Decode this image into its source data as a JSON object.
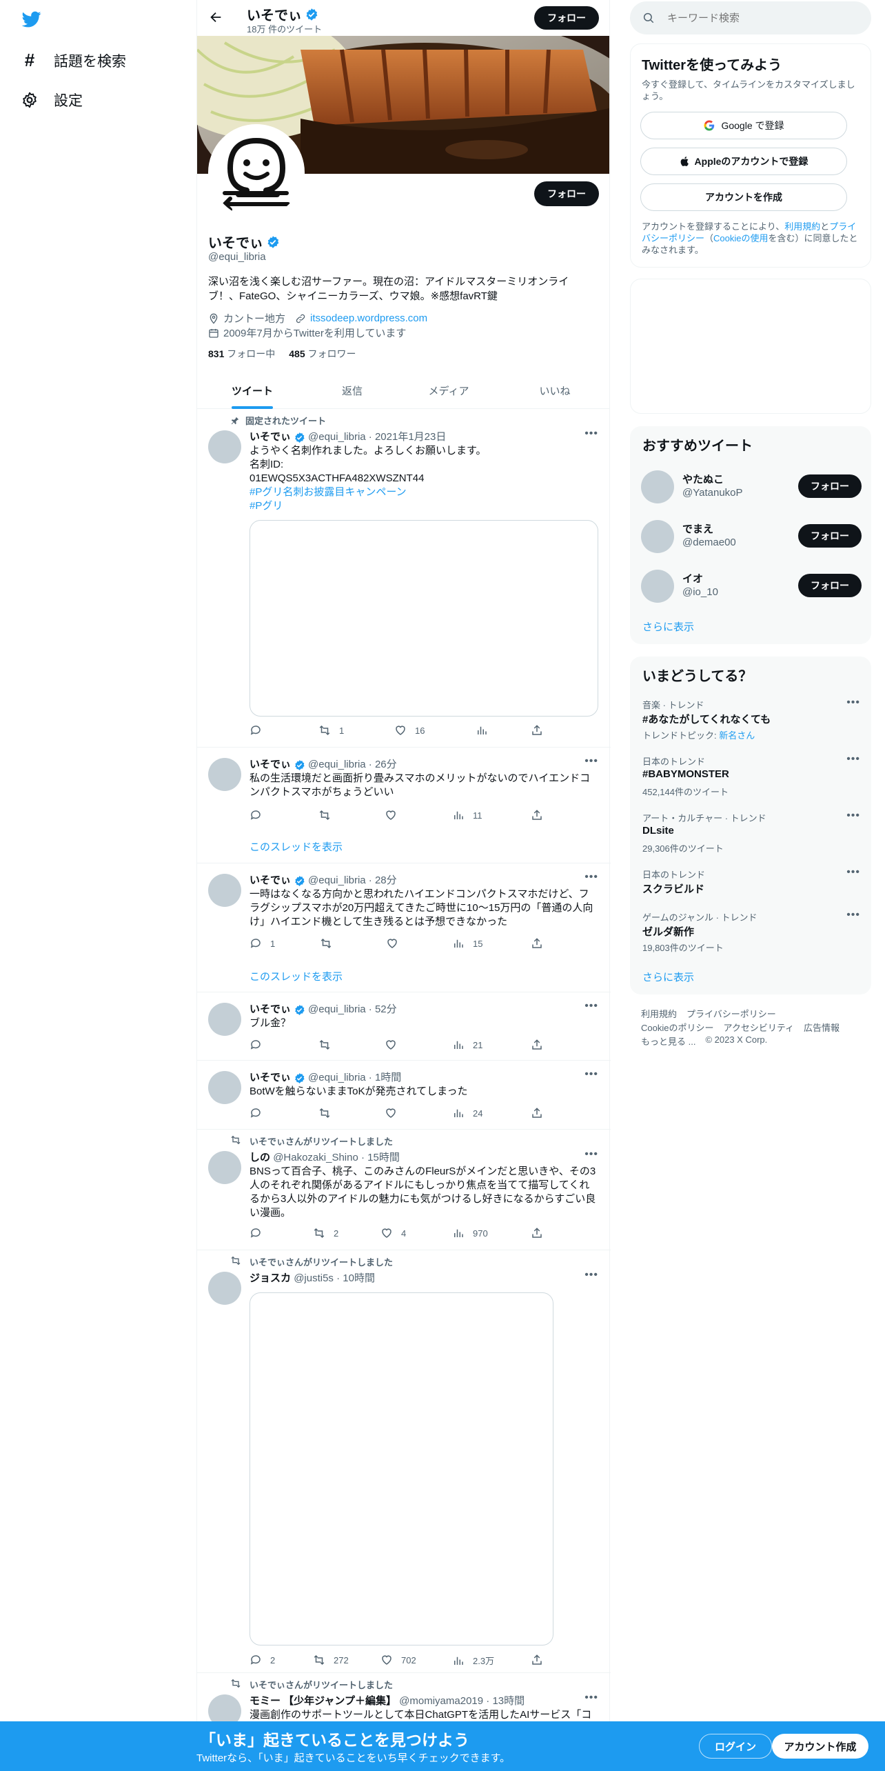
{
  "nav": {
    "explore_label": "話題を検索",
    "settings_label": "設定"
  },
  "header": {
    "name": "いそでぃ",
    "tweet_count": "18万 件のツイート",
    "follow_label": "フォロー"
  },
  "profile": {
    "name": "いそでぃ",
    "handle": "@equi_libria",
    "follow_label": "フォロー",
    "bio_line1": "深い沼を浅く楽しむ沼サーファー。現在の沼：アイドルマスターミリオンライ",
    "bio_line2": "ブ！、FateGO、シャイニーカラーズ、ウマ娘。※感想favRT鍵",
    "location": "カントー地方",
    "website": "itssodeep.wordpress.com",
    "joined": "2009年7月からTwitterを利用しています",
    "following_count": "831",
    "following_label": "フォロー中",
    "followers_count": "485",
    "followers_label": "フォロワー"
  },
  "tabs": [
    {
      "label": "ツイート"
    },
    {
      "label": "返信"
    },
    {
      "label": "メディア"
    },
    {
      "label": "いいね"
    }
  ],
  "pinned_label": "固定されたツイート",
  "tweets": [
    {
      "name": "いそでぃ",
      "handle": "@equi_libria",
      "time": "2021年1月23日",
      "line1": "ようやく名刺作れました。よろしくお願いします。",
      "line2": "名刺ID:",
      "line3": "01EWQS5X3ACTHFA482XWSZNT44",
      "tag1": "#Pグリ名刺お披露目キャンペーン",
      "tag2": "#Pグリ",
      "reply": "",
      "retweet": "1",
      "like": "16",
      "views": ""
    },
    {
      "name": "いそでぃ",
      "handle": "@equi_libria",
      "time": "26分",
      "line1": "私の生活環境だと画面折り畳みスマホのメリットがないのでハイエンドコ",
      "line2": "ンパクトスマホがちょうどいい",
      "reply": "",
      "retweet": "",
      "like": "",
      "views": "11",
      "thread": "このスレッドを表示"
    },
    {
      "name": "いそでぃ",
      "handle": "@equi_libria",
      "time": "28分",
      "line1": "一時はなくなる方向かと思われたハイエンドコンパクトスマホだけど、フ",
      "line2": "ラグシップスマホが20万円超えてきたご時世に10～15万円の「普通の人向",
      "line3": "け」ハイエンド機として生き残るとは予想できなかった",
      "reply": "1",
      "retweet": "",
      "like": "",
      "views": "15",
      "thread": "このスレッドを表示"
    },
    {
      "name": "いそでぃ",
      "handle": "@equi_libria",
      "time": "52分",
      "line1": "ブル金？",
      "reply": "",
      "retweet": "",
      "like": "",
      "views": "21"
    },
    {
      "name": "いそでぃ",
      "handle": "@equi_libria",
      "time": "1時間",
      "line1": "BotWを触らないままToKが発売されてしまった",
      "reply": "",
      "retweet": "",
      "like": "",
      "views": "24"
    },
    {
      "rt_by": "いそでぃさんがリツイートしました",
      "name": "しの",
      "handle": "@Hakozaki_Shino",
      "time": "15時間",
      "line1": "BNSって百合子、桃子、このみさんのFleurSがメインだと思いきや、その3",
      "line2": "人のそれぞれ関係があるアイドルにもしっかり焦点を当てて描写してくれ",
      "line3": "るから3人以外のアイドルの魅力にも気がつけるし好きになるからすごい良",
      "line4": "い漫画。",
      "reply": "",
      "retweet": "2",
      "like": "4",
      "views": "970"
    },
    {
      "rt_by": "いそでぃさんがリツイートしました",
      "name": "ジョスカ",
      "handle": "@justi5s",
      "time": "10時間",
      "reply": "2",
      "retweet": "272",
      "like": "702",
      "views": "2.3万"
    },
    {
      "rt_by": "いそでぃさんがリツイートしました",
      "name": "モミー 【少年ジャンプ＋編集】",
      "handle": "@momiyama2019",
      "time": "13時間",
      "line1": "漫画創作のサポートツールとして本日ChatGPTを活用したAIサービス「コ"
    }
  ],
  "search": {
    "placeholder": "キーワード検索"
  },
  "signup": {
    "title": "Twitterを使ってみよう",
    "subtitle": "今すぐ登録して、タイムラインをカスタマイズしましょう。",
    "google": "Google で登録",
    "apple": "Appleのアカウントで登録",
    "create": "アカウントを作成",
    "terms_1": "アカウントを登録することにより、",
    "terms_link1": "利用規約",
    "terms_2": "と",
    "terms_link2": "プライバシーポリシー",
    "terms_3": "（",
    "terms_link3": "Cookieの使用",
    "terms_4": "を含む）に同意したとみなされます。"
  },
  "who_to_follow": {
    "title": "おすすめツイート",
    "users": [
      {
        "name": "やたぬこ",
        "handle": "@YatanukoP",
        "follow": "フォロー"
      },
      {
        "name": "でまえ",
        "handle": "@demae00",
        "follow": "フォロー"
      },
      {
        "name": "イオ",
        "handle": "@io_10",
        "follow": "フォロー"
      }
    ],
    "more": "さらに表示"
  },
  "trends": {
    "title": "いまどうしてる？",
    "items": [
      {
        "category": "音楽 · トレンド",
        "name": "#あなたがしてくれなくても",
        "extra_prefix": "トレンドトピック: ",
        "extra_link": "新名さん"
      },
      {
        "category": "日本のトレンド",
        "name": "#BABYMONSTER",
        "count": "452,144件のツイート"
      },
      {
        "category": "アート・カルチャー · トレンド",
        "name": "DLsite",
        "count": "29,306件のツイート"
      },
      {
        "category": "日本のトレンド",
        "name": "スクラビルド"
      },
      {
        "category": "ゲームのジャンル · トレンド",
        "name": "ゼルダ新作",
        "count": "19,803件のツイート"
      }
    ],
    "more": "さらに表示"
  },
  "footer": {
    "terms": "利用規約",
    "privacy": "プライバシーポリシー",
    "cookie": "Cookieのポリシー",
    "accessibility": "アクセシビリティ",
    "ads": "広告情報",
    "more": "もっと見る ...",
    "copyright": "© 2023 X Corp."
  },
  "bottom_bar": {
    "title": "「いま」起きていることを見つけよう",
    "subtitle": "Twitterなら、「いま」起きていることをいち早くチェックできます。",
    "login": "ログイン",
    "signup": "アカウント作成"
  },
  "colors": {
    "accent": "#1d9bf0",
    "text": "#0f1419",
    "muted": "#536471",
    "panel": "#f7f9f9"
  }
}
